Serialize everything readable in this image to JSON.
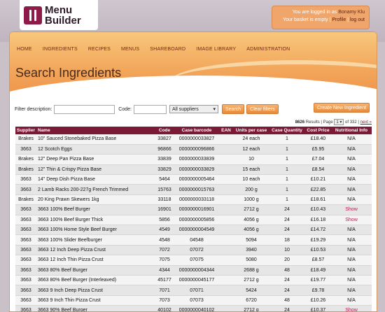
{
  "app": {
    "logo_line1": "Menu",
    "logo_line2": "Builder"
  },
  "account": {
    "logged_in_prefix": "You are logged in as",
    "user": "Bonamy Klu",
    "basket_text": "Your basket is empty |",
    "profile_link": "Profile",
    "logout_link": "log out"
  },
  "nav": [
    "HOME",
    "INGREDIENTS",
    "RECIPES",
    "MENUS",
    "SHAREBOARD",
    "IMAGE LIBRARY",
    "ADMINISTRATION"
  ],
  "page": {
    "title": "Search Ingredients"
  },
  "filters": {
    "description_label": "Filter description:",
    "description_value": "",
    "code_label": "Code:",
    "code_value": "",
    "supplier_selected": "All suppliers",
    "search_button": "Search",
    "clear_button": "Clear filters",
    "create_button": "Create New Ingredient"
  },
  "results": {
    "count": "8626",
    "results_label": "Results",
    "page_label": "Page",
    "page_value": "1",
    "page_total": "of 332",
    "next_label": "next »"
  },
  "table": {
    "headers": [
      "Supplier",
      "Name",
      "Code",
      "Case barcode",
      "EAN",
      "Units per case",
      "Case Quantity",
      "Cost Price",
      "Nutritional Info"
    ],
    "rows": [
      [
        "Brakes",
        "10\" Sauced Stonebaked Pizza Base",
        "33827",
        "0000000033827",
        "",
        "24 each",
        "1",
        "£18.40",
        "N/A"
      ],
      [
        "3663",
        "12 Scotch Eggs",
        "96866",
        "0000000096866",
        "",
        "12 each",
        "1",
        "£5.95",
        "N/A"
      ],
      [
        "Brakes",
        "12\" Deep Pan Pizza Base",
        "33839",
        "0000000033839",
        "",
        "10",
        "1",
        "£7.04",
        "N/A"
      ],
      [
        "Brakes",
        "12\" Thin & Crispy Pizza Base",
        "33829",
        "0000000033829",
        "",
        "15 each",
        "1",
        "£8.54",
        "N/A"
      ],
      [
        "3663",
        "14\" Deep Dish Pizza Base",
        "5464",
        "0000000005464",
        "",
        "10 each",
        "1",
        "£10.21",
        "N/A"
      ],
      [
        "3663",
        "2 Lamb Racks 200-227g French Trimmed",
        "15763",
        "0000000015763",
        "",
        "200 g",
        "1",
        "£22.85",
        "N/A"
      ],
      [
        "Brakes",
        "20 King Prawn Skewers 1kg",
        "33118",
        "0000000033118",
        "",
        "1000 g",
        "1",
        "£18.61",
        "N/A"
      ],
      [
        "3663",
        "3663 100% Beef Burger",
        "16901",
        "0000000016901",
        "",
        "2712 g",
        "24",
        "£10.43",
        "Show"
      ],
      [
        "3663",
        "3663 100% Beef Burger Thick",
        "5856",
        "0000000005856",
        "",
        "4056 g",
        "24",
        "£16.18",
        "Show"
      ],
      [
        "3663",
        "3663 100% Home Style Beef Burger",
        "4549",
        "0000000004549",
        "",
        "4056 g",
        "24",
        "£14.72",
        "N/A"
      ],
      [
        "3663",
        "3663 100% Slider Beefburger",
        "4548",
        "04548",
        "",
        "5094",
        "18",
        "£19.29",
        "N/A"
      ],
      [
        "3663",
        "3663 12 Inch Deep Pizza Crust",
        "7072",
        "07072",
        "",
        "3940",
        "10",
        "£10.53",
        "N/A"
      ],
      [
        "3663",
        "3663 12 Inch Thin Pizza Crust",
        "7075",
        "07075",
        "",
        "5080",
        "20",
        "£8.57",
        "N/A"
      ],
      [
        "3663",
        "3663 80% Beef Burger",
        "4344",
        "0000000004344",
        "",
        "2688 g",
        "48",
        "£18.49",
        "N/A"
      ],
      [
        "3663",
        "3663 80% Beef Burger (Interleaved)",
        "45177",
        "0000000045177",
        "",
        "2712 g",
        "24",
        "£19.77",
        "N/A"
      ],
      [
        "3663",
        "3663 9 Inch Deep Pizza Crust",
        "7071",
        "07071",
        "",
        "5424",
        "24",
        "£9.78",
        "N/A"
      ],
      [
        "3663",
        "3663 9 Inch Thin Pizza Crust",
        "7073",
        "07073",
        "",
        "6720",
        "48",
        "£10.26",
        "N/A"
      ],
      [
        "3663",
        "3663 90% Beef Burger",
        "40102",
        "0000000040102",
        "",
        "2712 g",
        "24",
        "£10.37",
        "Show"
      ]
    ]
  }
}
